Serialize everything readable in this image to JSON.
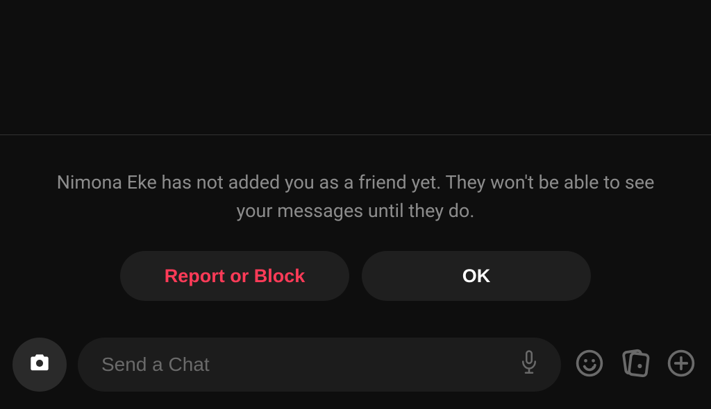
{
  "notice": {
    "text": "Nimona Eke has not added you as a friend yet. They won't be able to see your messages until they do."
  },
  "buttons": {
    "report": "Report or Block",
    "ok": "OK"
  },
  "input": {
    "placeholder": "Send a Chat"
  }
}
